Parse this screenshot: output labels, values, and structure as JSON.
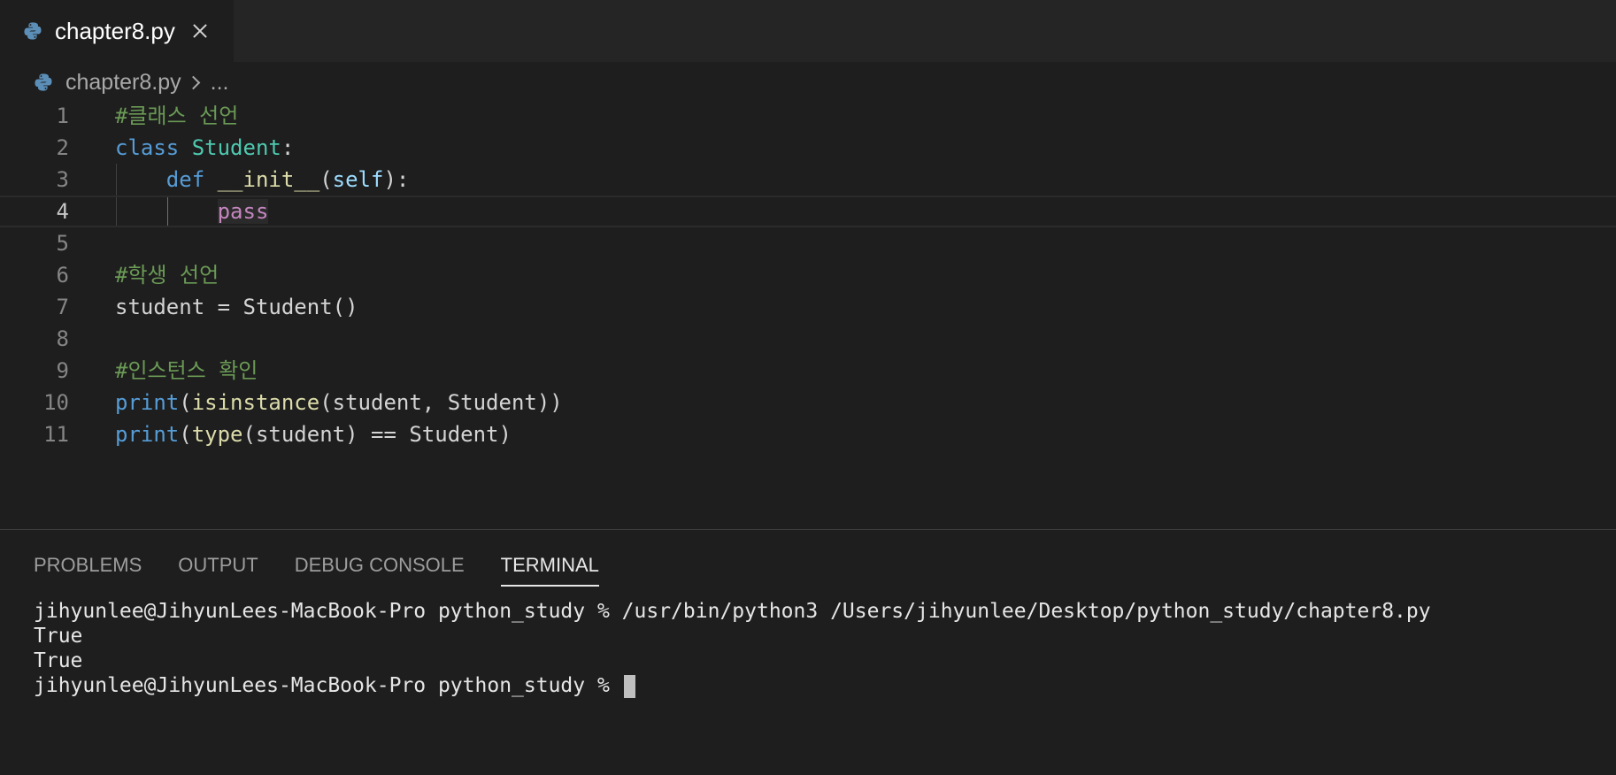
{
  "tab": {
    "label": "chapter8.py",
    "icon": "python-file-icon"
  },
  "breadcrumb": {
    "file": "chapter8.py",
    "more": "..."
  },
  "editor": {
    "current_line": 4,
    "lines": [
      {
        "n": "1",
        "tokens": [
          {
            "t": "#클래스 선언",
            "c": "comment"
          }
        ]
      },
      {
        "n": "2",
        "tokens": [
          {
            "t": "class",
            "c": "keyword"
          },
          {
            "t": " ",
            "c": "plain"
          },
          {
            "t": "Student",
            "c": "class"
          },
          {
            "t": ":",
            "c": "plain"
          }
        ]
      },
      {
        "n": "3",
        "tokens": [
          {
            "t": "    ",
            "c": "plain"
          },
          {
            "t": "def",
            "c": "keyword"
          },
          {
            "t": " ",
            "c": "plain"
          },
          {
            "t": "__init__",
            "c": "func"
          },
          {
            "t": "(",
            "c": "plain"
          },
          {
            "t": "self",
            "c": "param"
          },
          {
            "t": "):",
            "c": "plain"
          }
        ]
      },
      {
        "n": "4",
        "tokens": [
          {
            "t": "        ",
            "c": "plain"
          },
          {
            "t": "pass",
            "c": "ctrl"
          }
        ]
      },
      {
        "n": "5",
        "tokens": []
      },
      {
        "n": "6",
        "tokens": [
          {
            "t": "#학생 선언",
            "c": "comment"
          }
        ]
      },
      {
        "n": "7",
        "tokens": [
          {
            "t": "student = Student()",
            "c": "plain"
          }
        ]
      },
      {
        "n": "8",
        "tokens": []
      },
      {
        "n": "9",
        "tokens": [
          {
            "t": "#인스턴스 확인",
            "c": "comment"
          }
        ]
      },
      {
        "n": "10",
        "tokens": [
          {
            "t": "print",
            "c": "keyword"
          },
          {
            "t": "(",
            "c": "plain"
          },
          {
            "t": "isinstance",
            "c": "func"
          },
          {
            "t": "(student, Student))",
            "c": "plain"
          }
        ]
      },
      {
        "n": "11",
        "tokens": [
          {
            "t": "print",
            "c": "keyword"
          },
          {
            "t": "(",
            "c": "plain"
          },
          {
            "t": "type",
            "c": "func"
          },
          {
            "t": "(student) == Student)",
            "c": "plain"
          }
        ]
      }
    ]
  },
  "panel": {
    "tabs": [
      {
        "label": "PROBLEMS",
        "active": false
      },
      {
        "label": "OUTPUT",
        "active": false
      },
      {
        "label": "DEBUG CONSOLE",
        "active": false
      },
      {
        "label": "TERMINAL",
        "active": true
      }
    ]
  },
  "terminal": {
    "lines": [
      "jihyunlee@JihyunLees-MacBook-Pro python_study % /usr/bin/python3 /Users/jihyunlee/Desktop/python_study/chapter8.py",
      "True",
      "True"
    ],
    "prompt": "jihyunlee@JihyunLees-MacBook-Pro python_study % "
  },
  "colors": {
    "background": "#1e1e1e",
    "comment": "#6a9955",
    "keyword": "#569cd6",
    "class": "#4ec9b0",
    "function": "#dcdcaa",
    "parameter": "#9cdcfe",
    "control": "#c586c0"
  }
}
